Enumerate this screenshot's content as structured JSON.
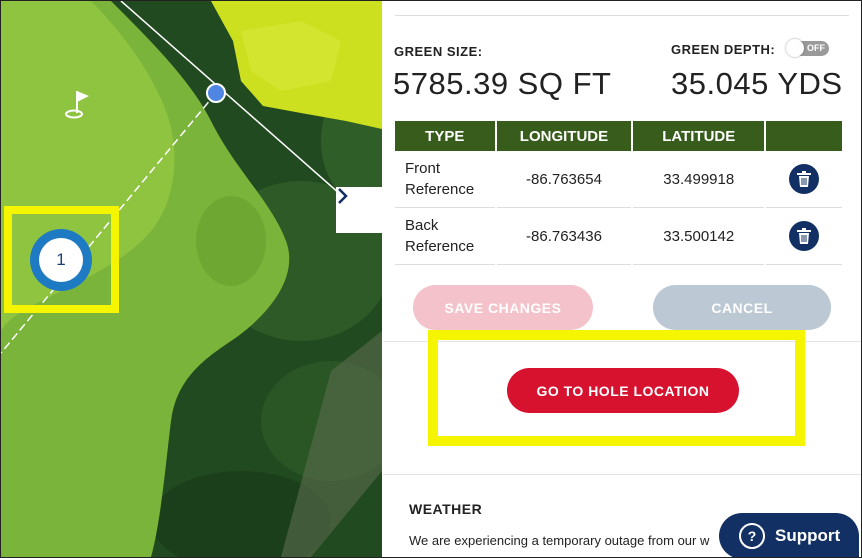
{
  "map": {
    "pin_number": "1"
  },
  "green": {
    "size_label": "GREEN SIZE:",
    "size_value": "5785.39 SQ FT",
    "depth_label": "GREEN DEPTH:",
    "depth_value": "35.045 YDS",
    "toggle_text": "OFF"
  },
  "table": {
    "headers": [
      "TYPE",
      "LONGITUDE",
      "LATITUDE",
      ""
    ],
    "rows": [
      {
        "type_line1": "Front",
        "type_line2": "Reference",
        "longitude": "-86.763654",
        "latitude": "33.499918"
      },
      {
        "type_line1": "Back",
        "type_line2": "Reference",
        "longitude": "-86.763436",
        "latitude": "33.500142"
      }
    ]
  },
  "buttons": {
    "save": "SAVE CHANGES",
    "cancel": "CANCEL",
    "goto": "GO TO HOLE LOCATION"
  },
  "weather": {
    "title": "WEATHER",
    "text": "We are experiencing a temporary outage from our w"
  },
  "support": {
    "icon": "?",
    "label": "Support"
  },
  "colors": {
    "header_green": "#385c1c",
    "goto_red": "#d6122f",
    "navy": "#123063",
    "highlight_yellow": "#f5f500"
  }
}
